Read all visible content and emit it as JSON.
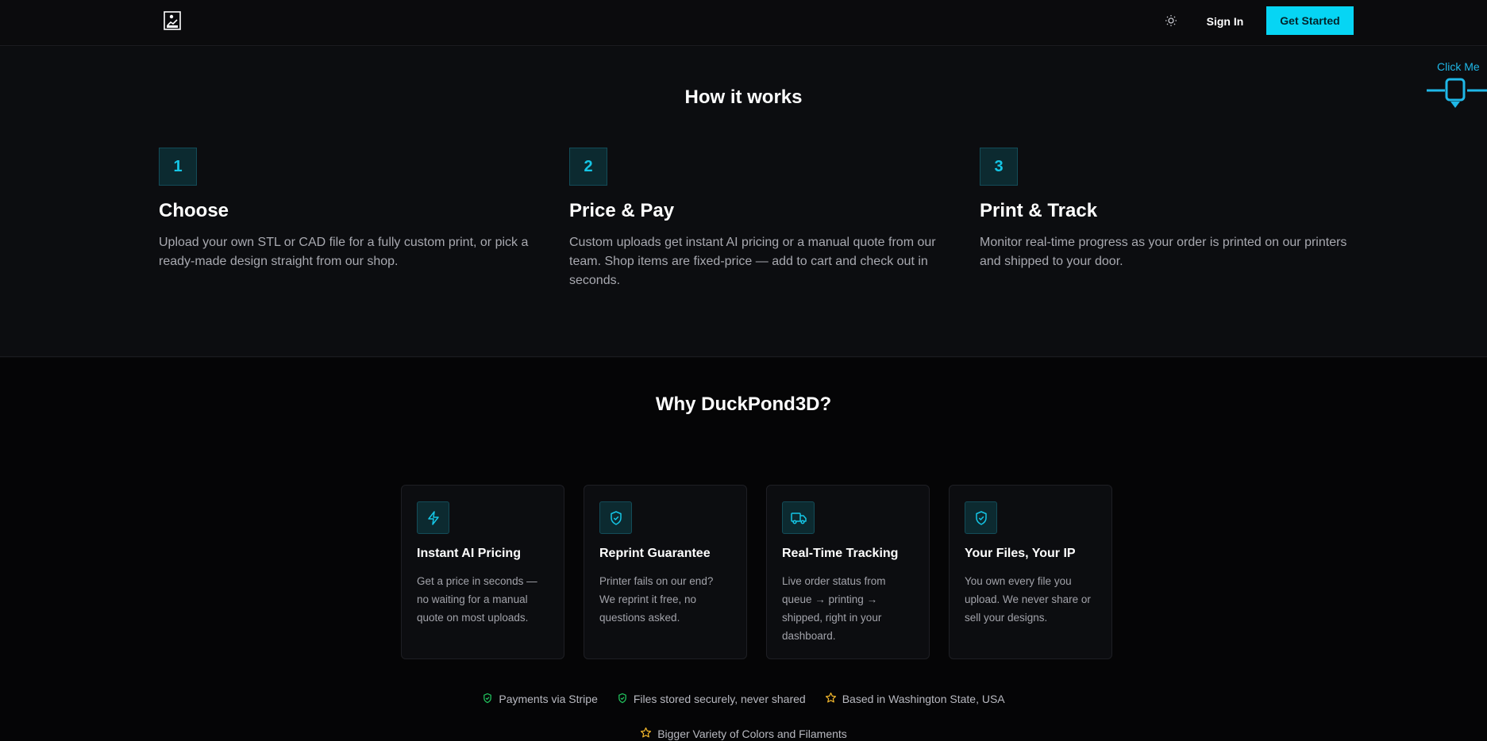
{
  "header": {
    "sign_in_label": "Sign In",
    "get_started_label": "Get Started",
    "accent": "#06d5f4"
  },
  "floating_widget": {
    "label": "Click Me"
  },
  "how_it_works": {
    "title": "How it works",
    "steps": [
      {
        "number": "1",
        "title": "Choose",
        "description": "Upload your own STL or CAD file for a fully custom print, or pick a ready-made design straight from our shop."
      },
      {
        "number": "2",
        "title": "Price & Pay",
        "description": "Custom uploads get instant AI pricing or a manual quote from our team. Shop items are fixed-price — add to cart and check out in seconds."
      },
      {
        "number": "3",
        "title": "Print & Track",
        "description": "Monitor real-time progress as your order is printed on our printers and shipped to your door."
      }
    ]
  },
  "why": {
    "title": "Why DuckPond3D?",
    "cards": [
      {
        "icon": "lightning-icon",
        "title": "Instant AI Pricing",
        "description": "Get a price in seconds — no waiting for a manual quote on most uploads."
      },
      {
        "icon": "shield-check-icon",
        "title": "Reprint Guarantee",
        "description": "Printer fails on our end? We reprint it free, no questions asked."
      },
      {
        "icon": "truck-icon",
        "title": "Real-Time Tracking",
        "description": "Live order status from queue → printing → shipped, right in your dashboard."
      },
      {
        "icon": "shield-check-icon",
        "title": "Your Files, Your IP",
        "description": "You own every file you upload. We never share or sell your designs."
      }
    ],
    "badges": [
      {
        "icon": "shield-check-icon",
        "label": "Payments via Stripe",
        "color": "#22c55e"
      },
      {
        "icon": "shield-check-icon",
        "label": "Files stored securely, never shared",
        "color": "#22c55e"
      },
      {
        "icon": "star-icon",
        "label": "Based in Washington State, USA",
        "color": "#f5b92c"
      },
      {
        "icon": "star-icon",
        "label": "Bigger Variety of Colors and Filaments",
        "color": "#f5b92c"
      }
    ]
  }
}
